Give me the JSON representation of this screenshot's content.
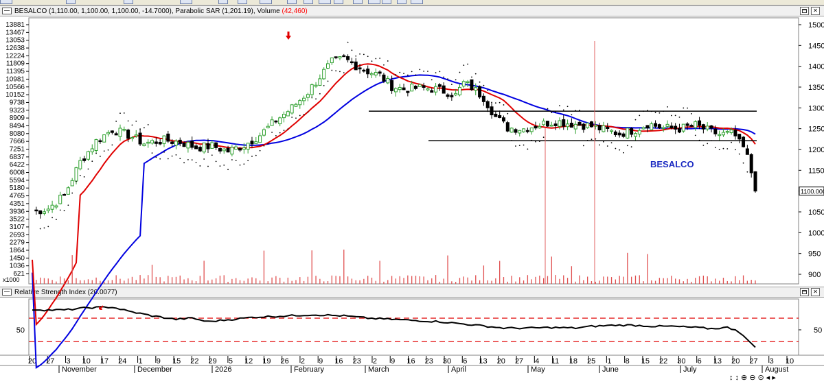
{
  "main_pane": {
    "title_prefix": "BESALCO (1,110.00, 1,100.00, 1,100.00, -14.7000), Parabolic SAR (1,201.19), Volume ",
    "title_volume": "(42,460)",
    "volume_color": "#ff0000",
    "watermark": "BESALCO",
    "watermark_color": "#1c2bc2",
    "last_price_label": "1100.000",
    "volume_multiplier_label": "x1000"
  },
  "rsi_pane": {
    "title": "Relative Strength Index (20.0077)"
  },
  "navigation": {
    "buttons": [
      "↕",
      "↕",
      "⊕",
      "⊖",
      "⊙",
      "◂",
      "▸"
    ]
  },
  "colors": {
    "sma_fast": "#e00000",
    "sma_slow": "#0000e0",
    "up_candle": "#2ea02e",
    "down_candle": "#000000",
    "volume_bar": "#e05050",
    "rsi_line": "#000000",
    "rsi_bands": "#e00000",
    "sar_dots": "#000000",
    "vertical_lines": "#e06060",
    "trend_lines": "#000000"
  },
  "chart_data": [
    {
      "type": "candlestick",
      "title": "BESALCO (1,110.00, 1,100.00, 1,100.00, -14.7000), Parabolic SAR (1,201.19), Volume (42,460)",
      "y_right_ticks": [
        900,
        950,
        1000,
        1050,
        1100,
        1150,
        1200,
        1250,
        1300,
        1350,
        1400,
        1450,
        1500
      ],
      "ylim": [
        880,
        1510
      ],
      "volume_ticks_left": [
        621,
        1036,
        1450,
        1864,
        2279,
        2693,
        3107,
        3522,
        3936,
        4351,
        4765,
        5180,
        5594,
        6008,
        6422,
        6837,
        7251,
        7666,
        8080,
        8494,
        8909,
        9323,
        9738,
        10152,
        10566,
        10981,
        11395,
        11809,
        12224,
        12638,
        13053,
        13467,
        13881
      ],
      "volume_unit": "x1000",
      "last_price": 1100.0,
      "x_day_ticks": [
        "20",
        "27",
        "3",
        "10",
        "17",
        "24",
        "1",
        "9",
        "15",
        "22",
        "29",
        "5",
        "12",
        "19",
        "26",
        "2",
        "9",
        "16",
        "23",
        "2",
        "9",
        "16",
        "23",
        "30",
        "6",
        "13",
        "20",
        "27",
        "4",
        "11",
        "18",
        "25",
        "1",
        "8",
        "15",
        "22",
        "30",
        "6",
        "13",
        "20",
        "27",
        "3",
        "10"
      ],
      "x_month_ticks": [
        "November",
        "December",
        "2026",
        "February",
        "March",
        "April",
        "May",
        "June",
        "July",
        "August"
      ],
      "sma_fast": {
        "name": "",
        "color": "#e00000"
      },
      "sma_slow": {
        "name": "",
        "color": "#0000e0"
      },
      "trend_lines": [
        {
          "y": 1292,
          "from": "Mar 2",
          "to": "Jul 30"
        },
        {
          "y": 1221,
          "from": "Mar 23",
          "to": "Jul 30"
        }
      ],
      "vertical_markers": [
        "May 11",
        "Jun 1"
      ],
      "annotations": [
        "Arrow above high near Feb 1",
        "BESALCO"
      ]
    },
    {
      "type": "line",
      "title": "Relative Strength Index (20.0077)",
      "y_ticks": [
        50
      ],
      "bands": [
        30,
        70
      ],
      "last_value": 20.0
    }
  ]
}
